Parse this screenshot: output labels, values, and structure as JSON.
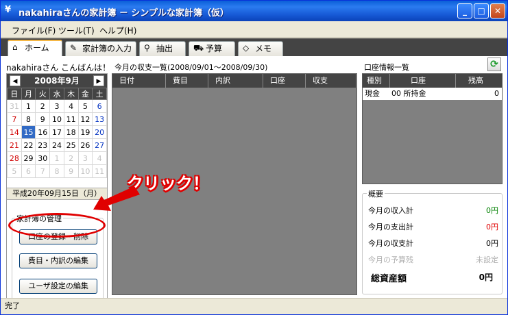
{
  "window": {
    "title": "nakahiraさんの家計簿 － シンプルな家計簿（仮）",
    "icon_glyph": "¥",
    "minimize": "_",
    "maximize": "□",
    "close": "✕"
  },
  "menu": [
    "ファイル(F)",
    "ツール(T)",
    "ヘルプ(H)"
  ],
  "tabs": [
    {
      "label": "ホーム",
      "icon": "home-icon",
      "glyph": "⌂"
    },
    {
      "label": "家計簿の入力",
      "icon": "pencil-icon",
      "glyph": "✎"
    },
    {
      "label": "抽出",
      "icon": "search-icon",
      "glyph": "⚲"
    },
    {
      "label": "予算",
      "icon": "cart-icon",
      "glyph": "⛟"
    },
    {
      "label": "メモ",
      "icon": "eraser-icon",
      "glyph": "◇"
    }
  ],
  "home": {
    "greeting": "nakahiraさん こんばんは！",
    "calendar": {
      "month_label": "2008年9月",
      "prev": "◀",
      "next": "▶",
      "weekdays": [
        "日",
        "月",
        "火",
        "水",
        "木",
        "金",
        "土"
      ],
      "weeks": [
        [
          "31",
          "1",
          "2",
          "3",
          "4",
          "5",
          "6"
        ],
        [
          "7",
          "8",
          "9",
          "10",
          "11",
          "12",
          "13"
        ],
        [
          "14",
          "15",
          "16",
          "17",
          "18",
          "19",
          "20"
        ],
        [
          "21",
          "22",
          "23",
          "24",
          "25",
          "26",
          "27"
        ],
        [
          "28",
          "29",
          "30",
          "1",
          "2",
          "3",
          "4"
        ],
        [
          "5",
          "6",
          "7",
          "8",
          "9",
          "10",
          "11"
        ]
      ],
      "selected_date": "平成20年09月15日（月）"
    },
    "management": {
      "title": "家計簿の管理",
      "buttons": [
        "口座の登録・削除",
        "費目・内訳の編集",
        "ユーザ設定の編集"
      ]
    },
    "transactions": {
      "label": "今月の収支一覧(2008/09/01～2008/09/30)",
      "columns": [
        "日付",
        "費目",
        "内訳",
        "口座",
        "収支"
      ]
    },
    "accounts": {
      "label": "口座情報一覧",
      "columns": [
        "種別",
        "口座",
        "残高"
      ],
      "rows": [
        {
          "type": "現金",
          "account": "00 所持金",
          "balance": "0"
        }
      ]
    },
    "summary": {
      "title": "概要",
      "rows": [
        {
          "label": "今月の収入計",
          "value": "0円",
          "color": "#008000"
        },
        {
          "label": "今月の支出計",
          "value": "0円",
          "color": "#e00000"
        },
        {
          "label": "今月の収支計",
          "value": "0円",
          "color": "#000000"
        },
        {
          "label": "今月の予算残",
          "value": "未設定",
          "color": "#b0b0b0"
        }
      ],
      "total_label": "総資産額",
      "total_value": "0円"
    }
  },
  "status": "完了",
  "annotation": {
    "text": "クリック！",
    "color": "#e00000"
  }
}
